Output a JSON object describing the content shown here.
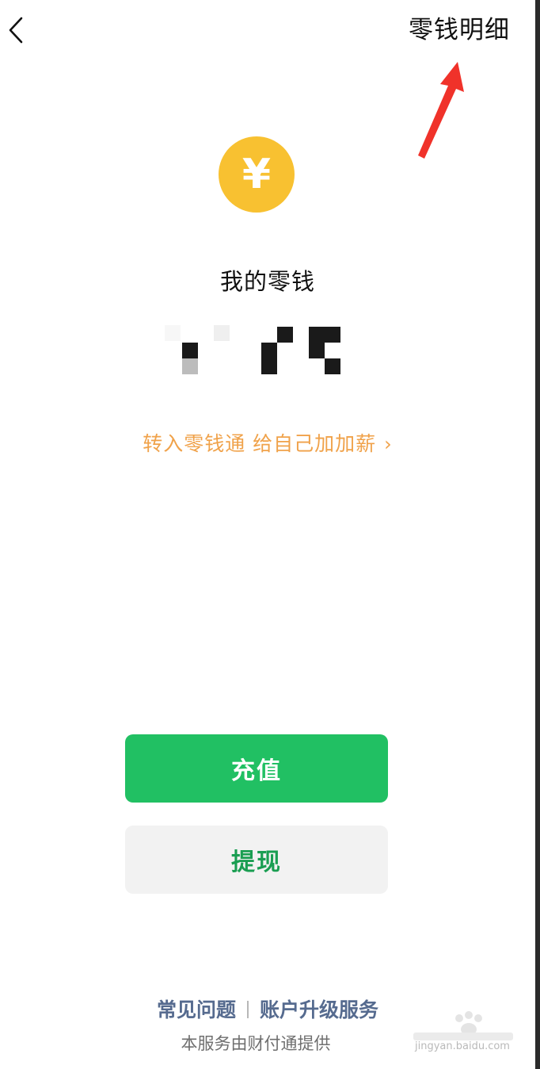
{
  "header": {
    "back_icon": "chevron-left-icon",
    "detail_label": "零钱明细"
  },
  "wallet": {
    "coin_icon": "yuan-coin-icon",
    "coin_glyph": "¥",
    "title": "我的零钱",
    "balance_masked": true
  },
  "promo": {
    "label": "转入零钱通 给自己加加薪",
    "chevron": "›"
  },
  "actions": {
    "recharge_label": "充值",
    "withdraw_label": "提现"
  },
  "footer": {
    "faq_label": "常见问题",
    "upgrade_label": "账户升级服务",
    "provider_text": "本服务由财付通提供"
  },
  "watermark": {
    "text": "jingyan.baidu.com"
  },
  "colors": {
    "accent_green": "#21c063",
    "withdraw_text": "#1a9e52",
    "coin_yellow": "#f8c131",
    "promo_orange": "#f0a24a",
    "footer_link": "#566b8f",
    "annotation_arrow": "#f0322a"
  }
}
